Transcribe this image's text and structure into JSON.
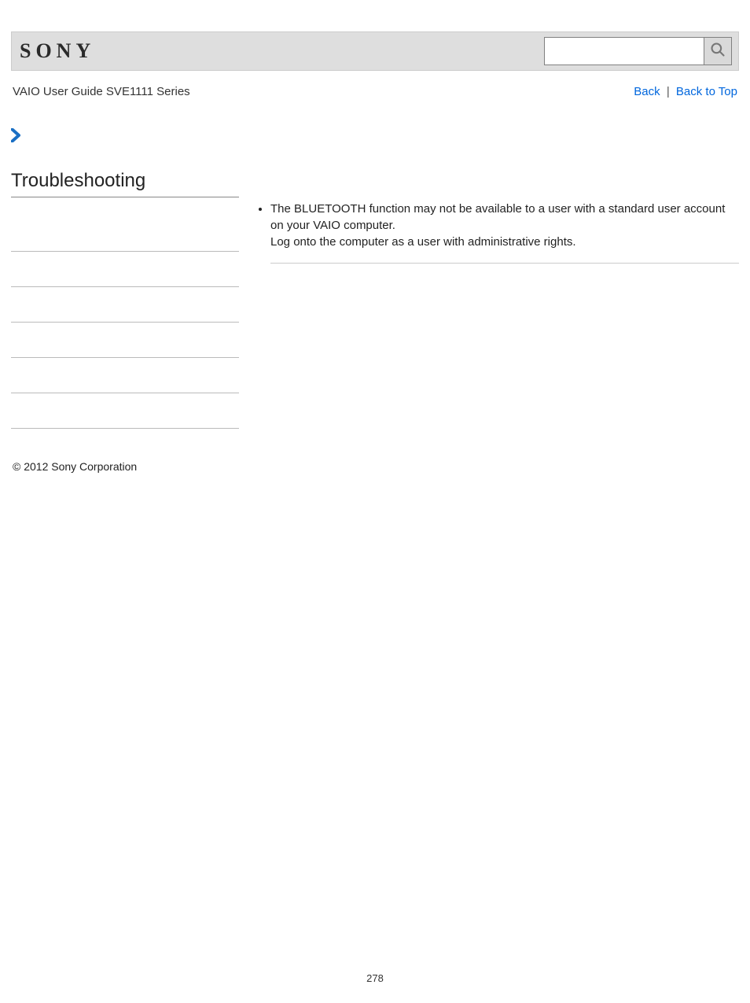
{
  "header": {
    "logo_text": "SONY",
    "search": {
      "value": "",
      "placeholder": ""
    }
  },
  "subheader": {
    "breadcrumb": "VAIO User Guide SVE1111 Series",
    "back_label": "Back",
    "separator": "|",
    "backtotop_label": "Back to Top"
  },
  "sidebar": {
    "title": "Troubleshooting"
  },
  "main": {
    "bullet1_line1": "The BLUETOOTH function may not be available to a user with a standard user account on your VAIO computer.",
    "bullet1_line2": "Log onto the computer as a user with administrative rights."
  },
  "footer": {
    "copyright": "© 2012 Sony Corporation",
    "page_number": "278"
  }
}
